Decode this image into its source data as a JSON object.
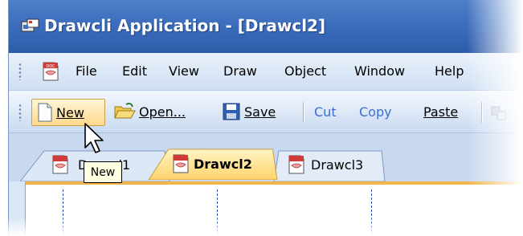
{
  "titlebar": {
    "title": "Drawcli Application - [Drawcl2]",
    "icon": "app-icon"
  },
  "menubar": {
    "doc_icon": "document-icon",
    "items": [
      {
        "label": "File"
      },
      {
        "label": "Edit"
      },
      {
        "label": "View"
      },
      {
        "label": "Draw"
      },
      {
        "label": "Object"
      },
      {
        "label": "Window"
      },
      {
        "label": "Help"
      }
    ]
  },
  "toolbar": {
    "new_label": "New",
    "open_label": "Open...",
    "save_label": "Save",
    "cut_label": "Cut",
    "copy_label": "Copy",
    "paste_label": "Paste",
    "hovered": "New"
  },
  "tabs": [
    {
      "label": "Drawcl1",
      "active": false
    },
    {
      "label": "Drawcl2",
      "active": true
    },
    {
      "label": "Drawcl3",
      "active": false
    }
  ],
  "tooltip": {
    "text": "New"
  },
  "colors": {
    "titlebar": "#3d6ebd",
    "active_tab": "#ffd36b",
    "hover_button": "#ffd98c",
    "doc_border": "#f0b54a"
  }
}
